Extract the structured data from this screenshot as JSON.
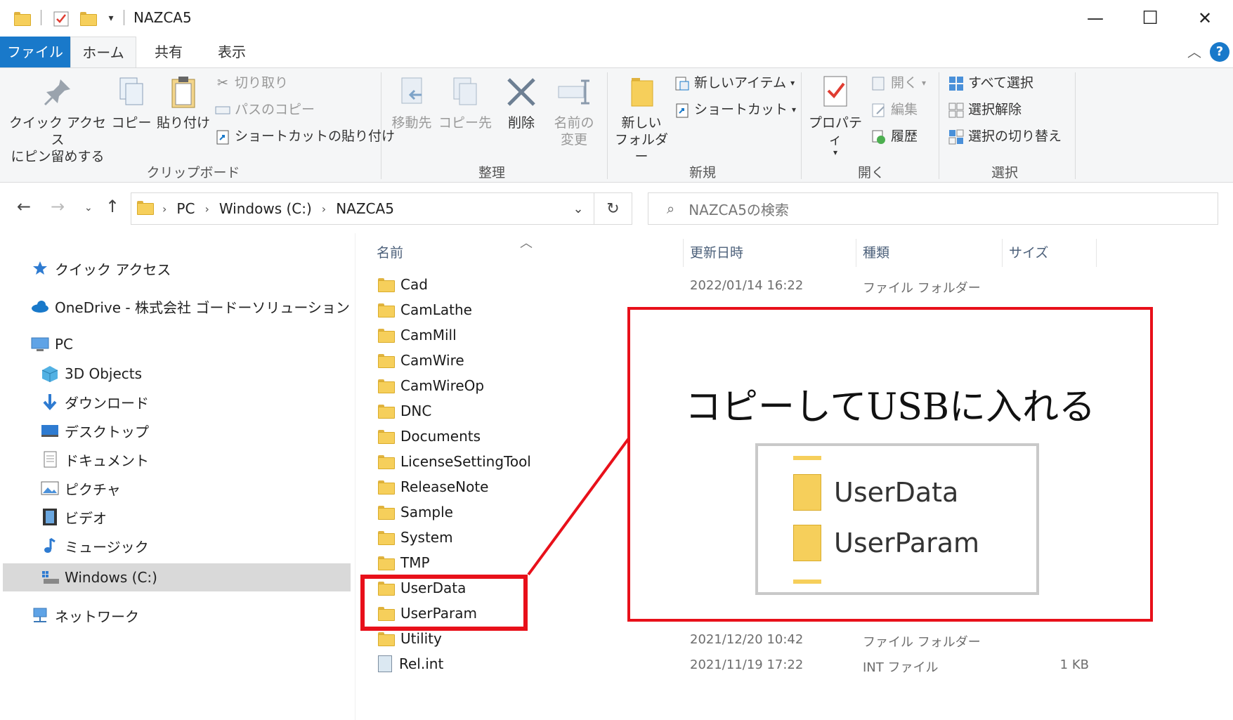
{
  "window": {
    "title": "NAZCA5",
    "minimize": "—",
    "maximize": "☐",
    "close": "✕"
  },
  "ribbon_tabs": {
    "file": "ファイル",
    "home": "ホーム",
    "share": "共有",
    "view": "表示"
  },
  "ribbon": {
    "clipboard": {
      "group": "クリップボード",
      "pin": "クイック アクセス\nにピン留めする",
      "copy": "コピー",
      "paste": "貼り付け",
      "cut": "切り取り",
      "copy_path": "パスのコピー",
      "paste_shortcut": "ショートカットの貼り付け"
    },
    "organize": {
      "group": "整理",
      "move_to": "移動先",
      "copy_to": "コピー先",
      "delete": "削除",
      "rename": "名前の\n変更"
    },
    "new": {
      "group": "新規",
      "new_folder": "新しい\nフォルダー",
      "new_item": "新しいアイテム",
      "shortcut": "ショートカット"
    },
    "open": {
      "group": "開く",
      "properties": "プロパティ",
      "open": "開く",
      "edit": "編集",
      "history": "履歴"
    },
    "select": {
      "group": "選択",
      "select_all": "すべて選択",
      "select_none": "選択解除",
      "invert": "選択の切り替え"
    }
  },
  "address": {
    "crumbs": [
      "PC",
      "Windows (C:)",
      "NAZCA5"
    ],
    "search_placeholder": "NAZCA5の検索"
  },
  "navpane": {
    "quick_access": "クイック アクセス",
    "onedrive": "OneDrive - 株式会社 ゴードーソリューション",
    "pc": "PC",
    "objects3d": "3D Objects",
    "downloads": "ダウンロード",
    "desktop": "デスクトップ",
    "documents": "ドキュメント",
    "pictures": "ピクチャ",
    "videos": "ビデオ",
    "music": "ミュージック",
    "windows_c": "Windows (C:)",
    "network": "ネットワーク"
  },
  "columns": {
    "name": "名前",
    "date": "更新日時",
    "type": "種類",
    "size": "サイズ"
  },
  "files": [
    {
      "name": "Cad",
      "date": "2022/01/14 16:22",
      "type": "ファイル フォルダー",
      "size": "",
      "kind": "folder"
    },
    {
      "name": "CamLathe",
      "date": "",
      "type": "",
      "size": "",
      "kind": "folder"
    },
    {
      "name": "CamMill",
      "date": "",
      "type": "",
      "size": "",
      "kind": "folder"
    },
    {
      "name": "CamWire",
      "date": "",
      "type": "",
      "size": "",
      "kind": "folder"
    },
    {
      "name": "CamWireOp",
      "date": "",
      "type": "",
      "size": "",
      "kind": "folder"
    },
    {
      "name": "DNC",
      "date": "",
      "type": "",
      "size": "",
      "kind": "folder"
    },
    {
      "name": "Documents",
      "date": "",
      "type": "",
      "size": "",
      "kind": "folder"
    },
    {
      "name": "LicenseSettingTool",
      "date": "",
      "type": "",
      "size": "",
      "kind": "folder"
    },
    {
      "name": "ReleaseNote",
      "date": "",
      "type": "",
      "size": "",
      "kind": "folder"
    },
    {
      "name": "Sample",
      "date": "",
      "type": "",
      "size": "",
      "kind": "folder"
    },
    {
      "name": "System",
      "date": "",
      "type": "",
      "size": "",
      "kind": "folder"
    },
    {
      "name": "TMP",
      "date": "",
      "type": "",
      "size": "",
      "kind": "folder"
    },
    {
      "name": "UserData",
      "date": "",
      "type": "",
      "size": "",
      "kind": "folder"
    },
    {
      "name": "UserParam",
      "date": "",
      "type": "",
      "size": "",
      "kind": "folder"
    },
    {
      "name": "Utility",
      "date": "2021/12/20 10:42",
      "type": "ファイル フォルダー",
      "size": "",
      "kind": "folder"
    },
    {
      "name": "Rel.int",
      "date": "2021/11/19 17:22",
      "type": "INT ファイル",
      "size": "1 KB",
      "kind": "file"
    }
  ],
  "annotation": {
    "text": "コピーしてUSBに入れる",
    "zoom_items": [
      "UserData",
      "UserParam"
    ],
    "color": "#e8101a"
  },
  "colors": {
    "accent": "#1979ca",
    "folder": "#f6cf5b"
  }
}
